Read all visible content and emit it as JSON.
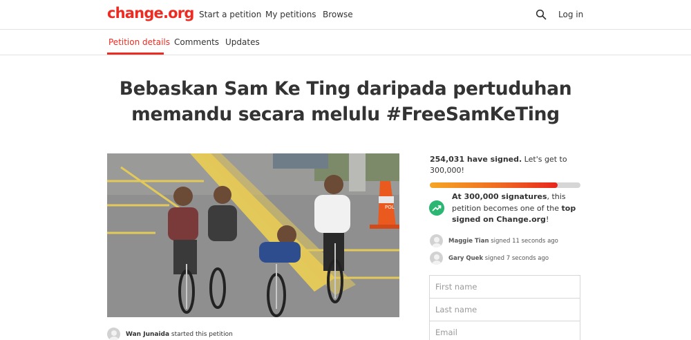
{
  "header": {
    "logo": "change.org",
    "nav": [
      "Start a petition",
      "My petitions",
      "Browse"
    ],
    "search_icon": "search-icon",
    "login": "Log in",
    "accent": "#ec2c22"
  },
  "tabs": [
    "Petition details",
    "Comments",
    "Updates"
  ],
  "petition": {
    "title_line1": "Bebaskan Sam Ke Ting daripada pertuduhan",
    "title_line2": "memandu secara melulu #FreeSamKeTing",
    "photo_sign": "POL",
    "starter_name": "Wan Junaida",
    "starter_suffix": " started this petition"
  },
  "sidebar": {
    "signed_count": "254,031 have signed.",
    "goal_text": " Let's get to 300,000!",
    "progress_fraction": 0.8468,
    "milestone_bold1": "At 300,000 signatures",
    "milestone_mid": ", this petition becomes one of the ",
    "milestone_bold2": "top signed on Change.org",
    "milestone_end": "!",
    "milestone_icon": "trending-up-icon",
    "milestone_color": "#2bb673",
    "recent_signers": [
      {
        "name": "Maggie Tian",
        "when": " signed 11 seconds ago"
      },
      {
        "name": "Gary Quek",
        "when": " signed 7 seconds ago"
      }
    ],
    "form": {
      "first_name": "First name",
      "last_name": "Last name",
      "email": "Email"
    }
  }
}
